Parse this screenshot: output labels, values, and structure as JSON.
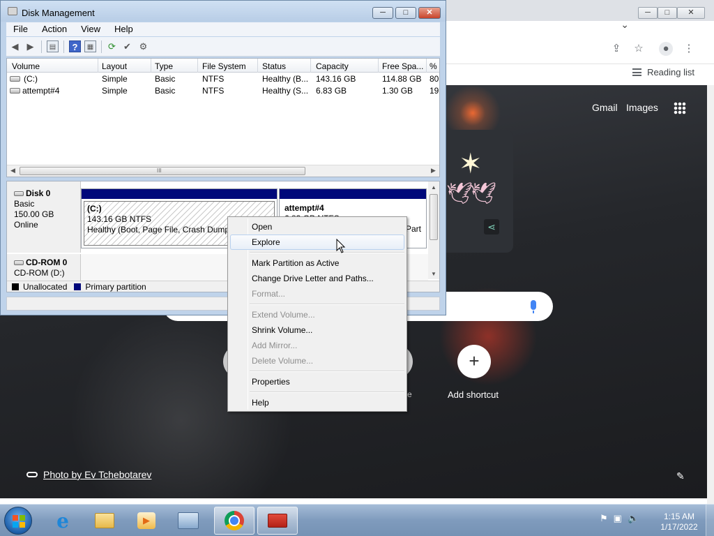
{
  "disk_management": {
    "title": "Disk Management",
    "window_controls": {
      "minimize": "─",
      "maximize": "□",
      "close": "✕"
    },
    "menu": [
      "File",
      "Action",
      "View",
      "Help"
    ],
    "toolbar_icons": [
      "back-arrow-icon",
      "forward-arrow-icon",
      "properties-icon",
      "help-icon",
      "console-icon",
      "refresh-icon",
      "rescan-icon",
      "settings-icon"
    ],
    "columns": [
      "Volume",
      "Layout",
      "Type",
      "File System",
      "Status",
      "Capacity",
      "Free Spa...",
      "% F"
    ],
    "volumes": [
      {
        "volume": "(C:)",
        "layout": "Simple",
        "type": "Basic",
        "fs": "NTFS",
        "status": "Healthy (B...",
        "capacity": "143.16 GB",
        "free": "114.88 GB",
        "pct": "80"
      },
      {
        "volume": "attempt#4",
        "layout": "Simple",
        "type": "Basic",
        "fs": "NTFS",
        "status": "Healthy (S...",
        "capacity": "6.83 GB",
        "free": "1.30 GB",
        "pct": "19"
      }
    ],
    "scroll_grip": "III",
    "disk0": {
      "name": "Disk 0",
      "type": "Basic",
      "size": "150.00 GB",
      "state": "Online"
    },
    "partition_c": {
      "title": "(C:)",
      "size": "143.16 GB NTFS",
      "status": "Healthy (Boot, Page File, Crash Dump,"
    },
    "partition_attempt": {
      "title": "attempt#4",
      "size": "6.83 GB NTFS",
      "status_tail": "Part"
    },
    "cdrom": {
      "name": "CD-ROM 0",
      "drive": "CD-ROM (D:)"
    },
    "legend": [
      {
        "label": "Unallocated",
        "color": "#000000"
      },
      {
        "label": "Primary partition",
        "color": "#00087a"
      }
    ]
  },
  "context_menu": {
    "items": [
      {
        "label": "Open",
        "enabled": true
      },
      {
        "label": "Explore",
        "enabled": true,
        "hover": true
      },
      {
        "label": "Mark Partition as Active",
        "enabled": true
      },
      {
        "label": "Change Drive Letter and Paths...",
        "enabled": true
      },
      {
        "label": "Format...",
        "enabled": false
      },
      {
        "label": "Extend Volume...",
        "enabled": false
      },
      {
        "label": "Shrink Volume...",
        "enabled": true
      },
      {
        "label": "Add Mirror...",
        "enabled": false
      },
      {
        "label": "Delete Volume...",
        "enabled": false
      },
      {
        "label": "Properties",
        "enabled": true
      },
      {
        "label": "Help",
        "enabled": true
      }
    ]
  },
  "chrome": {
    "reading_list": "Reading list",
    "gmail": "Gmail",
    "images": "Images",
    "add_shortcut": "Add shortcut",
    "ghost_shortcut_tail": "re",
    "photo_credit": "Photo by Ev Tchebotarev",
    "plus": "+"
  },
  "taskbar": {
    "apps": [
      "internet-explorer",
      "windows-explorer",
      "media-player",
      "server-manager",
      "google-chrome",
      "toolbox"
    ],
    "time": "1:15 AM",
    "date": "1/17/2022"
  },
  "colors": {
    "primary_partition": "#00087a",
    "hover_border": "#b8d0ee"
  }
}
